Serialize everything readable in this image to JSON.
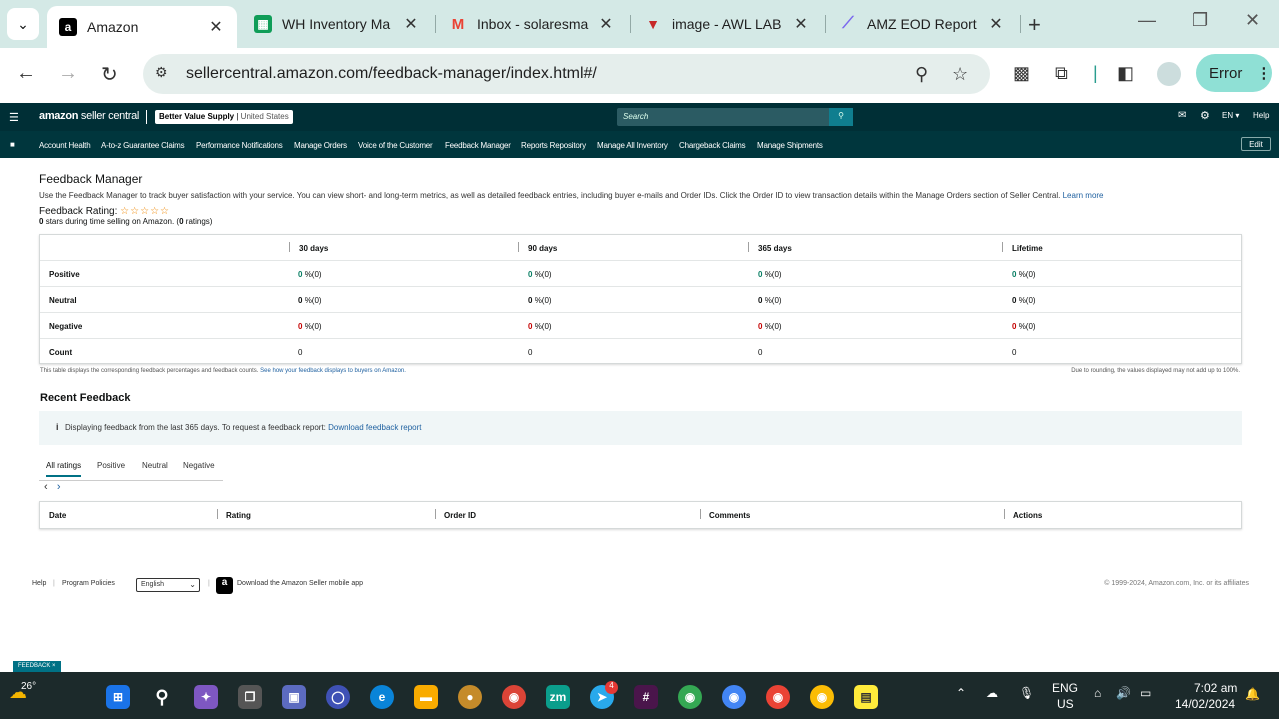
{
  "browser": {
    "tabs": [
      {
        "title": "Amazon",
        "icon": "amazon-icon",
        "fav_text": "a",
        "fav_color": "#000000"
      },
      {
        "title": "WH Inventory Ma",
        "icon": "sheets-icon",
        "fav_text": "▦",
        "fav_color": "#0f9d58"
      },
      {
        "title": "Inbox - solaresma",
        "icon": "gmail-icon",
        "fav_text": "M",
        "fav_color": "#ea4335"
      },
      {
        "title": "image - AWL LAB",
        "icon": "awl-icon",
        "fav_text": "▼",
        "fav_color": "#c62828"
      },
      {
        "title": "AMZ EOD Report",
        "icon": "clickup-icon",
        "fav_text": "⟋",
        "fav_color": "#7b68ee"
      }
    ],
    "url": "sellercentral.amazon.com/feedback-manager/index.html#/",
    "error_label": "Error"
  },
  "header": {
    "logo_main": "amazon",
    "logo_sub": "seller central",
    "account_name": "Better Value Supply",
    "account_region": "United States",
    "search_placeholder": "Search",
    "lang": "EN",
    "help": "Help"
  },
  "nav": {
    "items": [
      "Account Health",
      "A-to-z Guarantee Claims",
      "Performance Notifications",
      "Manage Orders",
      "Voice of the Customer",
      "Feedback Manager",
      "Reports Repository",
      "Manage All Inventory",
      "Chargeback Claims",
      "Manage Shipments"
    ],
    "edit": "Edit"
  },
  "page": {
    "title": "Feedback Manager",
    "description": "Use the Feedback Manager to track buyer satisfaction with your service. You can view short- and long-term metrics, as well as detailed feedback entries, including buyer e-mails and Order IDs. Click the Order ID to view transaction details within the Manage Orders section of Seller Central.",
    "learn_more": "Learn more",
    "rating_label": "Feedback Rating:",
    "stars": "☆☆☆☆☆",
    "rating_count": "0",
    "rating_mid": "stars during time selling on Amazon. (",
    "rating_ratings_count": "0",
    "rating_end": "ratings)",
    "columns": [
      "30 days",
      "90 days",
      "365 days",
      "Lifetime"
    ],
    "rows": [
      {
        "label": "Positive",
        "values": [
          "0",
          "0",
          "0",
          "0"
        ],
        "suffix": "%(0)"
      },
      {
        "label": "Neutral",
        "values": [
          "0",
          "0",
          "0",
          "0"
        ],
        "suffix": "%(0)"
      },
      {
        "label": "Negative",
        "values": [
          "0",
          "0",
          "0",
          "0"
        ],
        "suffix": "%(0)"
      },
      {
        "label": "Count",
        "values": [
          "0",
          "0",
          "0",
          "0"
        ]
      }
    ],
    "table_note": "This table displays the corresponding feedback percentages and feedback counts.",
    "table_note_link": "See how your feedback displays to buyers on Amazon.",
    "rounding_note": "Due to rounding, the values displayed may not add up to 100%.",
    "recent_title": "Recent Feedback",
    "info_text": "Displaying feedback from the last 365 days. To request a feedback report:",
    "info_link": "Download feedback report",
    "filter_tabs": [
      "All ratings",
      "Positive",
      "Neutral",
      "Negative"
    ],
    "recent_columns": [
      "Date",
      "Rating",
      "Order ID",
      "Comments",
      "Actions"
    ]
  },
  "footer": {
    "help": "Help",
    "policies": "Program Policies",
    "language": "English",
    "app": "Download the Amazon Seller mobile app",
    "copyright": "© 1999-2024, Amazon.com, Inc. or its affiliates",
    "feedback_tag": "FEEDBACK ×"
  },
  "taskbar": {
    "temp": "26°",
    "lang1": "ENG",
    "lang2": "US",
    "time": "7:02 am",
    "date": "14/02/2024",
    "telegram_badge": "4"
  }
}
